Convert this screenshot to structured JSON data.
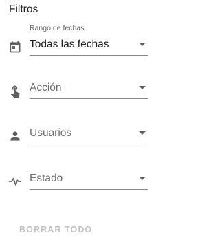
{
  "panel": {
    "title": "Filtros"
  },
  "filters": {
    "date_range": {
      "label": "Rango de fechas",
      "value": "Todas las fechas",
      "icon": "calendar-icon"
    },
    "action": {
      "placeholder": "Acción",
      "icon": "touch-hand-icon"
    },
    "users": {
      "placeholder": "Usuarios",
      "icon": "person-icon"
    },
    "status": {
      "placeholder": "Estado",
      "icon": "activity-pulse-icon"
    }
  },
  "actions": {
    "clear_all_label": "BORRAR TODO"
  },
  "colors": {
    "text_primary": "#212121",
    "text_secondary": "#616161",
    "underline": "#8c8c8c",
    "disabled_button": "#c2c2c2",
    "icon": "#616161"
  }
}
